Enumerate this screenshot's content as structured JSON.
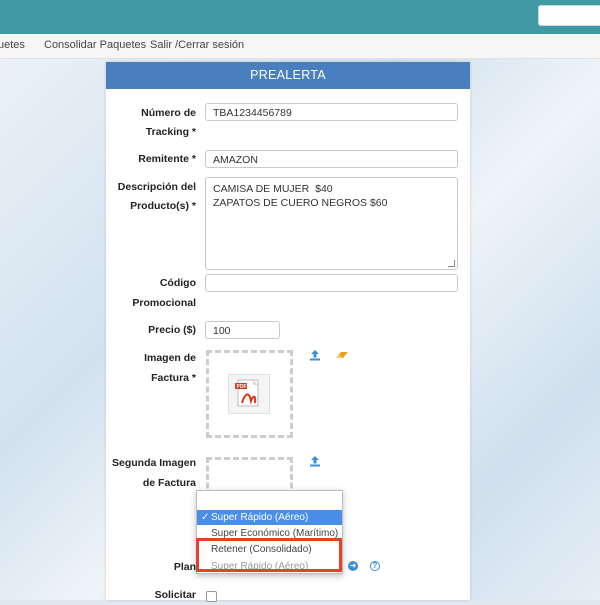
{
  "nav": {
    "items": [
      "uetes",
      "Consolidar Paquetes",
      "Salir /Cerrar sesión"
    ]
  },
  "panel": {
    "title": "PREALERTA"
  },
  "form": {
    "tracking_label_1": "Número de",
    "tracking_label_2": "Tracking *",
    "tracking_value": "TBA1234456789",
    "remitente_label": "Remitente *",
    "remitente_value": "AMAZON",
    "descripcion_label_1": "Descripción del",
    "descripcion_label_2": "Producto(s) *",
    "descripcion_line_1": "CAMISA DE MUJER  $40",
    "descripcion_line_2": "ZAPATOS DE CUERO NEGROS $60",
    "codigo_label_1": "Código",
    "codigo_label_2": "Promocional",
    "codigo_value": "",
    "precio_label": "Precio ($)",
    "precio_value": "100",
    "imagen_label_1": "Imagen de",
    "imagen_label_2": "Factura *",
    "segunda_label_1": "Segunda Imagen",
    "segunda_label_2": "de Factura",
    "plan_label": "Plan",
    "solicitar_label": "Solicitar"
  },
  "dropdown": {
    "options": [
      "",
      "Super Rápido (Aéreo)",
      "Super Económico (Marítimo)",
      "Retener (Consolidado)",
      "Super Rápido (Aéreo)"
    ],
    "selected_index": 1,
    "check_glyph": "✓"
  },
  "colors": {
    "topbar": "#3f9aa6",
    "panel_header": "#4a7fbf",
    "selected_option": "#4a8fe7",
    "highlight_box": "#e8412b",
    "upload_icon": "#3a8fd6",
    "eraser_icon": "#e8a21c"
  },
  "icons": [
    "upload-icon",
    "eraser-icon",
    "pdf-file-icon",
    "arrow-right-circle-icon",
    "help-circle-icon"
  ]
}
